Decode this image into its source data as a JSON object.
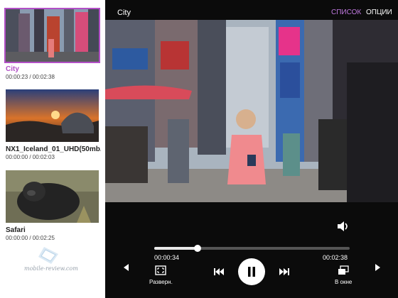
{
  "playlist": [
    {
      "title": "City",
      "time": "00:00:23 / 00:02:38",
      "selected": true
    },
    {
      "title": "NX1_Iceland_01_UHD(50mb...",
      "time": "00:00:00 / 00:02:03",
      "selected": false
    },
    {
      "title": "Safari",
      "time": "00:00:00 / 00:02:25",
      "selected": false
    }
  ],
  "watermark": "mobile-review.com",
  "player": {
    "title": "City",
    "list_label": "СПИСОК",
    "options_label": "ОПЦИИ",
    "current_time": "00:00:34",
    "total_time": "00:02:38",
    "progress": 0.22,
    "fullscreen_label": "Разверн.",
    "popup_label": "В окне"
  },
  "colors": {
    "accent": "#b24fc6",
    "list_link": "#c079e0"
  }
}
